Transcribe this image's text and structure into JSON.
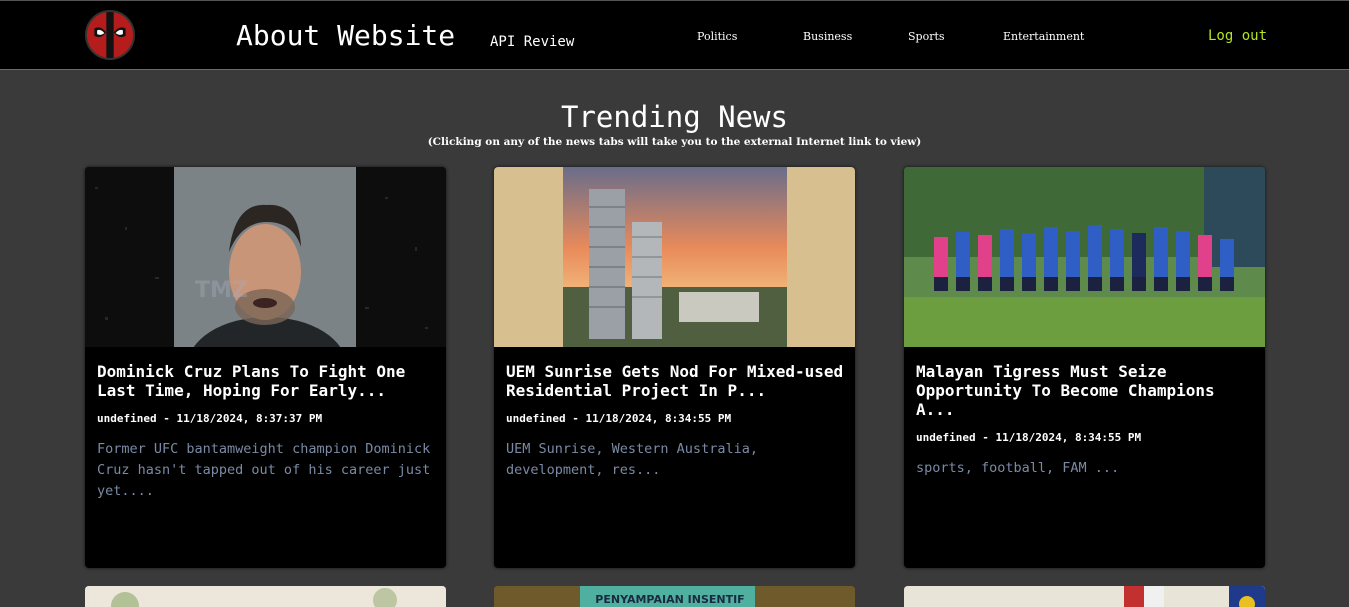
{
  "header": {
    "brand": "About Website",
    "api_review": "API Review",
    "nav": [
      "Politics",
      "Business",
      "Sports",
      "Entertainment"
    ],
    "logout": "Log out"
  },
  "main": {
    "title": "Trending News",
    "subtitle": "(Clicking on any of the news tabs will take you to the external Internet link to view)"
  },
  "cards": [
    {
      "title": "Dominick Cruz Plans To Fight One Last Time, Hoping For Early...",
      "meta": "undefined - 11/18/2024, 8:37:37 PM",
      "description": "Former UFC bantamweight champion Dominick Cruz hasn't tapped out of his career just yet...."
    },
    {
      "title": "UEM Sunrise Gets Nod For Mixed-used Residential Project In P...",
      "meta": "undefined - 11/18/2024, 8:34:55 PM",
      "description": "UEM Sunrise, Western Australia,  development,  res..."
    },
    {
      "title": "Malayan Tigress Must Seize Opportunity To Become Champions A...",
      "meta": "undefined - 11/18/2024, 8:34:55 PM",
      "description": "sports, football, FAM  ..."
    }
  ],
  "bottom_cards": [
    {
      "image": "trees-photo"
    },
    {
      "image": "event-banner-photo"
    },
    {
      "image": "flags-photo"
    }
  ],
  "bottom_banner_text": "PENYAMPAIAN INSENTIF",
  "colors": {
    "background": "#3a3a3a",
    "navbar": "#000000",
    "logout": "#b5e61d",
    "description": "#7a8aa5"
  }
}
